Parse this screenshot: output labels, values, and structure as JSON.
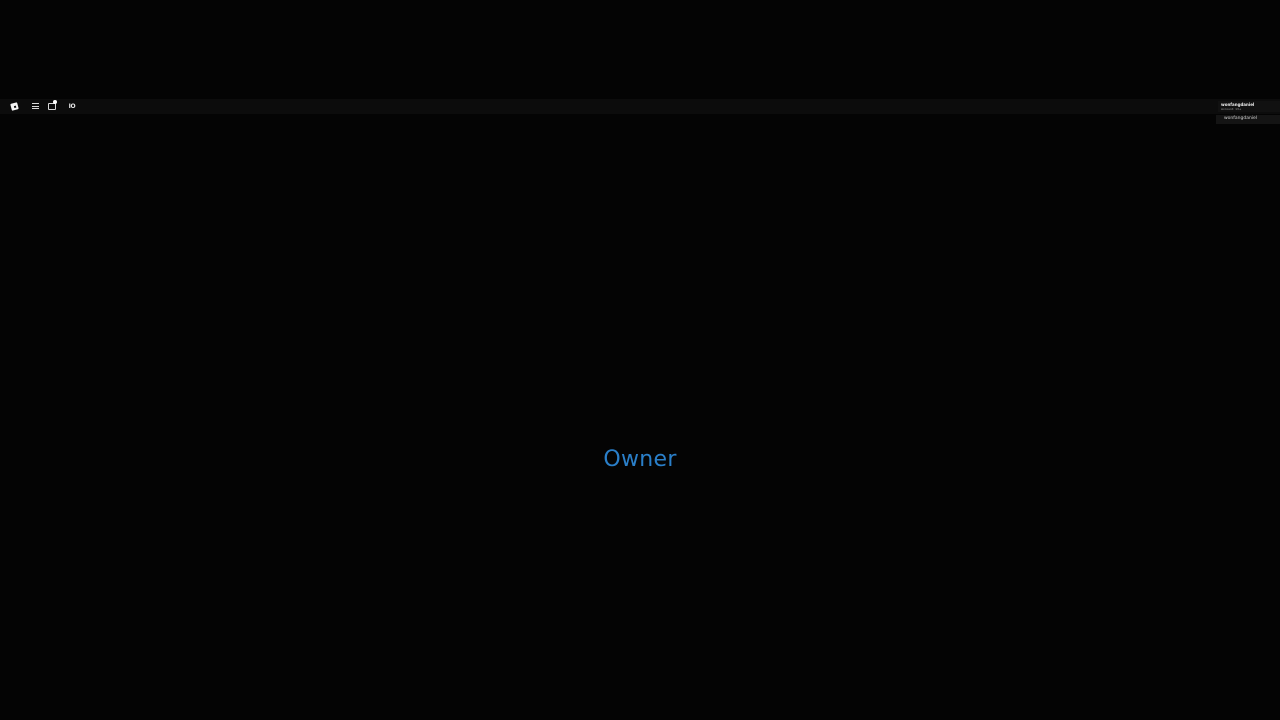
{
  "topbar": {
    "logo_icon": "roblox-logo-icon",
    "menu_icon": "hamburger-menu-icon",
    "chat_icon": "chat-icon",
    "voice_label": "IO"
  },
  "leaderboard": {
    "header_name": "wonfangdaniel",
    "header_stat": "Account: 13+",
    "players": [
      {
        "name": "wonfangdaniel"
      }
    ]
  },
  "overlay": {
    "title": "Owner",
    "color": "#2a7fc9"
  },
  "colors": {
    "background": "#040404",
    "topbar": "#0c0c0c"
  }
}
